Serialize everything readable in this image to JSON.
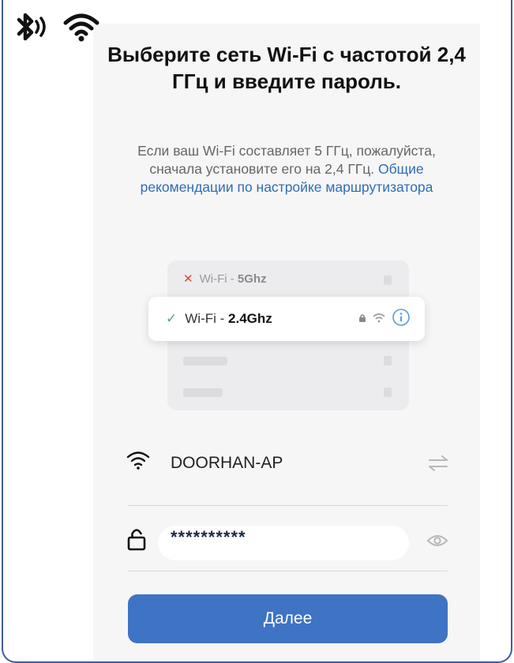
{
  "page": {
    "title": "Выберите сеть Wi-Fi с частотой 2,4 ГГц и введите пароль.",
    "description": "Если ваш Wi-Fi составляет 5 ГГц, пожалуйста, сначала установите его на 2,4 ГГц.",
    "link_text": "Общие рекомендации по настройке маршрутизатора"
  },
  "illustration": {
    "network_5ghz_prefix": "Wi-Fi - ",
    "network_5ghz_band": "5Ghz",
    "network_24ghz_prefix": "Wi-Fi - ",
    "network_24ghz_band": "2.4Ghz"
  },
  "form": {
    "ssid": "DOORHAN-AP",
    "password_masked": "**********"
  },
  "actions": {
    "next_label": "Далее"
  },
  "colors": {
    "accent": "#3f73c4",
    "link": "#2f6db6",
    "check": "#4cae70",
    "cross": "#e0443b",
    "frame": "#3f5aa6"
  },
  "icons": {
    "status": [
      "bluetooth-icon",
      "wifi-icon"
    ],
    "ssid_row": [
      "wifi-icon",
      "switch-network-icon"
    ],
    "password_row": [
      "lock-icon",
      "eye-icon"
    ],
    "card": [
      "lock-icon",
      "wifi-icon",
      "info-icon"
    ]
  }
}
